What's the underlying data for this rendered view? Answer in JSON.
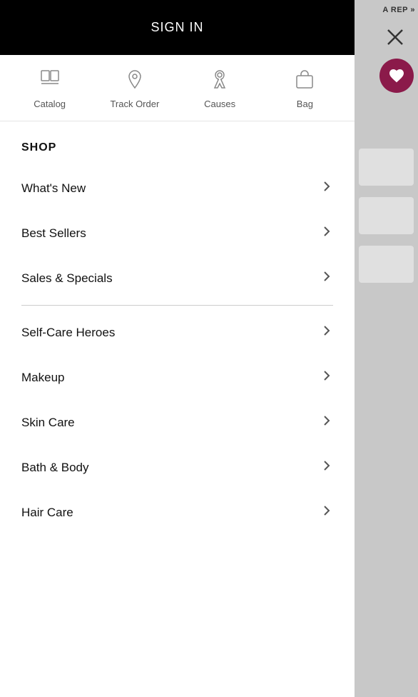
{
  "header": {
    "sign_in_label": "SIGN IN",
    "become_rep_label": "A REP »"
  },
  "nav": {
    "items": [
      {
        "id": "catalog",
        "label": "Catalog",
        "icon": "catalog-icon"
      },
      {
        "id": "track-order",
        "label": "Track Order",
        "icon": "location-icon"
      },
      {
        "id": "causes",
        "label": "Causes",
        "icon": "ribbon-icon"
      },
      {
        "id": "bag",
        "label": "Bag",
        "icon": "bag-icon"
      }
    ]
  },
  "shop": {
    "heading": "SHOP",
    "items": [
      {
        "id": "whats-new",
        "label": "What's New"
      },
      {
        "id": "best-sellers",
        "label": "Best Sellers"
      },
      {
        "id": "sales-specials",
        "label": "Sales & Specials"
      },
      {
        "id": "self-care-heroes",
        "label": "Self-Care Heroes"
      },
      {
        "id": "makeup",
        "label": "Makeup"
      },
      {
        "id": "skin-care",
        "label": "Skin Care"
      },
      {
        "id": "bath-body",
        "label": "Bath & Body"
      },
      {
        "id": "hair-care",
        "label": "Hair Care"
      }
    ],
    "divider_after_index": 2
  },
  "actions": {
    "close_label": "close",
    "wishlist_label": "wishlist"
  },
  "colors": {
    "sign_in_bg": "#000000",
    "wishlist_bg": "#8b1a4a"
  }
}
